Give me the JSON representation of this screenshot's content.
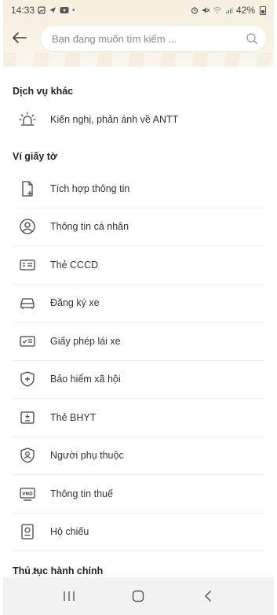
{
  "status_bar": {
    "time": "14:33",
    "battery": "42%",
    "left_icons": [
      "gallery-icon",
      "location-icon",
      "youtube-icon",
      "dot-icon"
    ],
    "right_icons": [
      "alarm-icon",
      "mute-icon",
      "wifi-icon",
      "signal-icon",
      "battery-icon"
    ]
  },
  "search": {
    "placeholder": "Bạn đang muốn tìm kiếm ..."
  },
  "sections": {
    "other_services": {
      "title": "Dịch vụ khác",
      "items": [
        {
          "label": "Kiến nghị, phản ánh về ANTT",
          "icon": "siren-icon"
        }
      ]
    },
    "wallet": {
      "title": "Ví giấy tờ",
      "items": [
        {
          "label": "Tích hợp thông tin",
          "icon": "add-document-icon"
        },
        {
          "label": "Thông tin cá nhân",
          "icon": "person-circle-icon"
        },
        {
          "label": "Thẻ CCCD",
          "icon": "id-card-icon"
        },
        {
          "label": "Đăng ký xe",
          "icon": "car-icon"
        },
        {
          "label": "Giấy phép lái xe",
          "icon": "license-icon"
        },
        {
          "label": "Bảo hiểm xã hội",
          "icon": "shield-plus-icon"
        },
        {
          "label": "Thẻ BHYT",
          "icon": "health-card-icon"
        },
        {
          "label": "Người phụ thuộc",
          "icon": "dependent-icon"
        },
        {
          "label": "Thông tin thuế",
          "icon": "tax-icon"
        },
        {
          "label": "Hộ chiếu",
          "icon": "passport-icon"
        }
      ]
    },
    "admin": {
      "title": "Thủ tục hành chính"
    }
  },
  "colors": {
    "header_bg": "#f6efe0",
    "icon_stroke": "#444444",
    "divider": "#eeeeee",
    "nav_bg": "#f2f2f2"
  },
  "nav": {
    "buttons": [
      "recent-apps-icon",
      "home-icon",
      "back-icon"
    ]
  }
}
